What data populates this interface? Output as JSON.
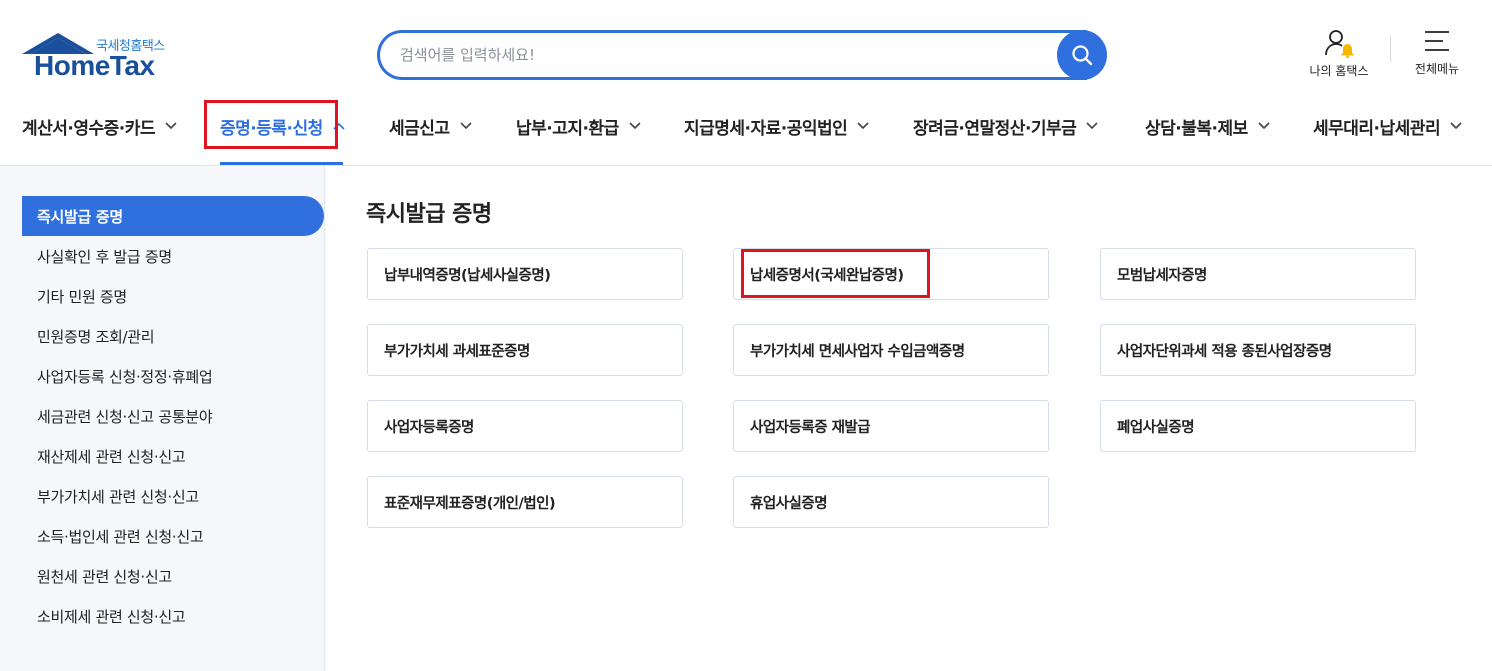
{
  "logo": {
    "sub": "국세청홈택스",
    "main": "HomeTax"
  },
  "search": {
    "placeholder": "검색어를 입력하세요!"
  },
  "header": {
    "my_hometax": "나의 홈택스",
    "all_menu": "전체메뉴"
  },
  "gnb": [
    {
      "label": "계산서·영수증·카드"
    },
    {
      "label": "증명·등록·신청"
    },
    {
      "label": "세금신고"
    },
    {
      "label": "납부·고지·환급"
    },
    {
      "label": "지급명세·자료·공익법인"
    },
    {
      "label": "장려금·연말정산·기부금"
    },
    {
      "label": "상담·불복·제보"
    },
    {
      "label": "세무대리·납세관리"
    }
  ],
  "sidebar": {
    "items": [
      {
        "label": "즉시발급 증명"
      },
      {
        "label": "사실확인 후 발급 증명"
      },
      {
        "label": "기타 민원 증명"
      },
      {
        "label": "민원증명 조회/관리"
      },
      {
        "label": "사업자등록 신청·정정·휴폐업"
      },
      {
        "label": "세금관련 신청·신고 공통분야"
      },
      {
        "label": "재산제세 관련 신청·신고"
      },
      {
        "label": "부가가치세 관련 신청·신고"
      },
      {
        "label": "소득·법인세 관련 신청·신고"
      },
      {
        "label": "원천세 관련 신청·신고"
      },
      {
        "label": "소비제세 관련 신청·신고"
      }
    ]
  },
  "main": {
    "title": "즉시발급 증명",
    "cards": [
      {
        "label": "납부내역증명(납세사실증명)"
      },
      {
        "label": "납세증명서(국세완납증명)"
      },
      {
        "label": "모범납세자증명"
      },
      {
        "label": "부가가치세 과세표준증명"
      },
      {
        "label": "부가가치세 면세사업자 수입금액증명"
      },
      {
        "label": "사업자단위과세 적용 종된사업장증명"
      },
      {
        "label": "사업자등록증명"
      },
      {
        "label": "사업자등록증 재발급"
      },
      {
        "label": "폐업사실증명"
      },
      {
        "label": "표준재무제표증명(개인/법인)"
      },
      {
        "label": "휴업사실증명"
      }
    ]
  },
  "colors": {
    "accent": "#2f6fde",
    "highlight": "#e0141e",
    "logo_blue": "#1a4f9c",
    "sidebar_bg": "#f5f7fa"
  },
  "icons": [
    "house-logo-icon",
    "search-icon",
    "user-bell-icon",
    "hamburger-menu-icon",
    "chevron-down-icon",
    "chevron-up-icon"
  ]
}
